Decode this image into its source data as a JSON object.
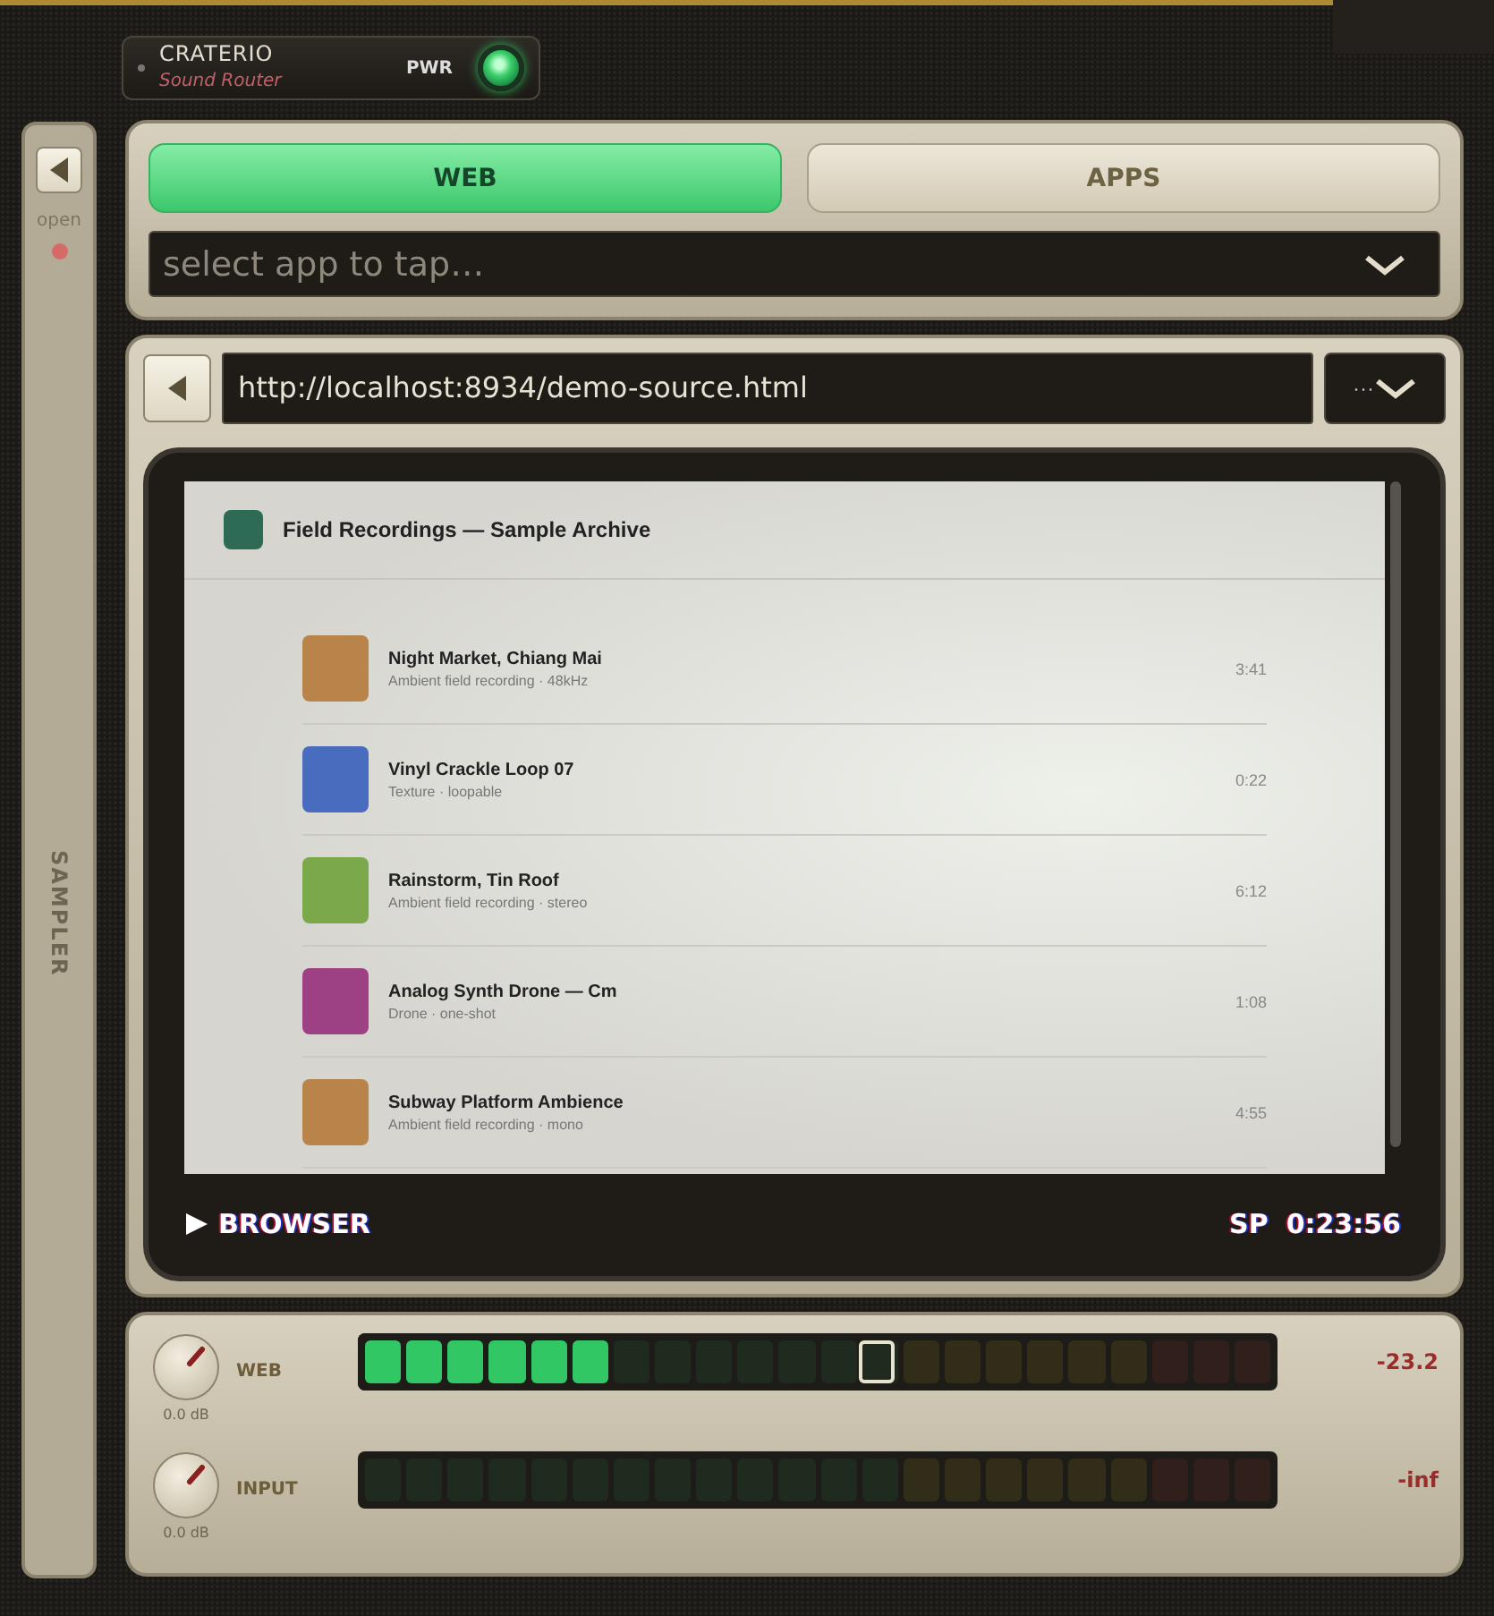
{
  "device": {
    "brand": "CRATERIO",
    "subtitle": "Sound Router",
    "power_label": "PWR",
    "power_on": true
  },
  "sidebar": {
    "toggle_label": "open",
    "indicator_on": true,
    "title": "SAMPLER"
  },
  "source_tabs": [
    {
      "label": "WEB",
      "selected": true
    },
    {
      "label": "APPS",
      "selected": false
    }
  ],
  "app_select": {
    "placeholder": "select app to tap…"
  },
  "browser": {
    "url": "http://localhost:8934/demo-source.html",
    "menu_dots": "···"
  },
  "page": {
    "title": "Field Recordings — Sample Archive",
    "logo": {
      "color": "#2e6b57"
    },
    "tracks": [
      {
        "name": "Night Market, Chiang Mai",
        "detail": "Ambient field recording · 48kHz",
        "duration": "3:41",
        "color": "#b8844a"
      },
      {
        "name": "Vinyl Crackle Loop 07",
        "detail": "Texture · loopable",
        "duration": "0:22",
        "color": "#4a6cbf"
      },
      {
        "name": "Rainstorm, Tin Roof",
        "detail": "Ambient field recording · stereo",
        "duration": "6:12",
        "color": "#7aa84a"
      },
      {
        "name": "Analog Synth Drone — Cm",
        "detail": "Drone · one-shot",
        "duration": "1:08",
        "color": "#9e4184"
      },
      {
        "name": "Subway Platform Ambience",
        "detail": "Ambient field recording · mono",
        "duration": "4:55",
        "color": "#b8844a"
      }
    ]
  },
  "screen_footer": {
    "mode": "BROWSER",
    "speed": "SP",
    "time": "0:23:56"
  },
  "channels": [
    {
      "name": "WEB",
      "gain": "0.0 dB",
      "level": 0.273,
      "peak": {
        "level": 0.591
      },
      "reading": "-23.2"
    },
    {
      "name": "INPUT",
      "gain": "0.0 dB",
      "level": 0,
      "reading": "-inf"
    }
  ]
}
